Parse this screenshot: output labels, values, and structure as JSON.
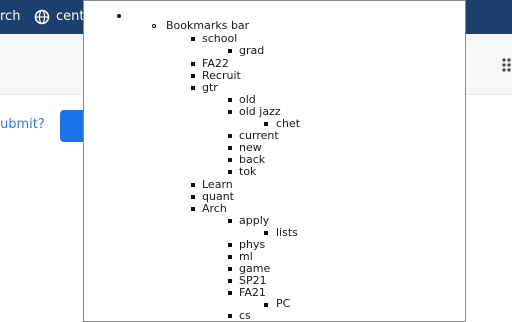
{
  "background": {
    "left_text": "rch",
    "center_text": "cent",
    "submit_text": "ubmit?"
  },
  "tree": {
    "root_label": "Bookmarks bar",
    "items": [
      {
        "label": "school"
      },
      {
        "label": "grad"
      },
      {
        "label": "FA22"
      },
      {
        "label": "Recruit"
      },
      {
        "label": "gtr"
      },
      {
        "label": "old"
      },
      {
        "label": "old jazz"
      },
      {
        "label": "chet"
      },
      {
        "label": "current"
      },
      {
        "label": "new"
      },
      {
        "label": "back"
      },
      {
        "label": "tok"
      },
      {
        "label": "Learn"
      },
      {
        "label": "quant"
      },
      {
        "label": "Arch"
      },
      {
        "label": "apply"
      },
      {
        "label": "lists"
      },
      {
        "label": "phys"
      },
      {
        "label": "ml"
      },
      {
        "label": "game"
      },
      {
        "label": "SP21"
      },
      {
        "label": "FA21"
      },
      {
        "label": "PC"
      },
      {
        "label": "cs"
      }
    ]
  },
  "colors": {
    "topbar": "#1c3f6e",
    "accent_button": "#1a73e8",
    "link_text": "#3c78d8"
  }
}
